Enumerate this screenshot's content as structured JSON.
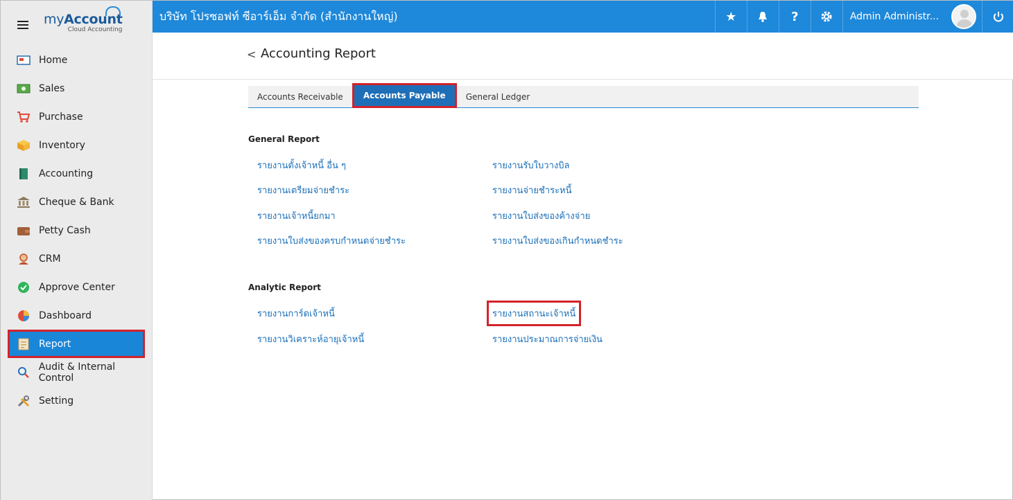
{
  "brand": {
    "name_prefix": "my",
    "name_main": "Account",
    "tagline": "Cloud Accounting"
  },
  "topbar": {
    "company": "บริษัท โปรซอฟท์ ซีอาร์เอ็ม จำกัด (สำนักงานใหญ่)",
    "user_name": "Admin Administr..."
  },
  "sidebar": {
    "items": [
      {
        "label": "Home",
        "icon": "home-icon"
      },
      {
        "label": "Sales",
        "icon": "money-icon"
      },
      {
        "label": "Purchase",
        "icon": "cart-icon"
      },
      {
        "label": "Inventory",
        "icon": "box-icon"
      },
      {
        "label": "Accounting",
        "icon": "book-icon"
      },
      {
        "label": "Cheque & Bank",
        "icon": "bank-icon"
      },
      {
        "label": "Petty Cash",
        "icon": "wallet-icon"
      },
      {
        "label": "CRM",
        "icon": "crm-icon"
      },
      {
        "label": "Approve Center",
        "icon": "check-circle-icon"
      },
      {
        "label": "Dashboard",
        "icon": "pie-chart-icon"
      },
      {
        "label": "Report",
        "icon": "report-icon",
        "active": true
      },
      {
        "label": "Audit & Internal Control",
        "icon": "magnifier-icon"
      },
      {
        "label": "Setting",
        "icon": "tools-icon"
      }
    ]
  },
  "page": {
    "back_icon": "<",
    "title": "Accounting Report"
  },
  "tabs": [
    "Accounts Receivable",
    "Accounts Payable",
    "General Ledger"
  ],
  "general_report": {
    "title": "General Report",
    "left": [
      "รายงานตั้งเจ้าหนี้ อื่น ๆ",
      "รายงานเตรียมจ่ายชำระ",
      "รายงานเจ้าหนี้ยกมา",
      "รายงานใบส่งของครบกำหนดจ่ายชำระ"
    ],
    "right": [
      "รายงานรับใบวางบิล",
      "รายงานจ่ายชำระหนี้",
      "รายงานใบส่งของค้างจ่าย",
      "รายงานใบส่งของเกินกำหนดชำระ"
    ]
  },
  "analytic_report": {
    "title": "Analytic Report",
    "left": [
      "รายงานการ์ดเจ้าหนี้",
      "รายงานวิเคราะห์อายุเจ้าหนี้"
    ],
    "right": [
      "รายงานสถานะเจ้าหนี้",
      "รายงานประมาณการจ่ายเงิน"
    ]
  },
  "colors": {
    "topbar": "#1e88da",
    "active": "#1a86d8",
    "highlight": "#d3222a",
    "link": "#1a6fb8"
  }
}
